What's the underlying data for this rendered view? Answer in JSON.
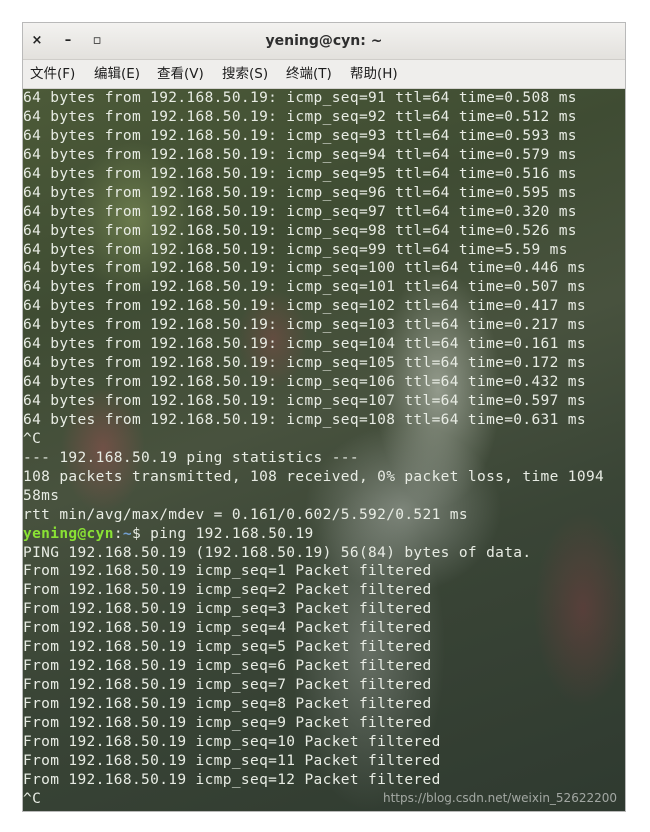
{
  "window": {
    "title": "yening@cyn: ~",
    "close_glyph": "×",
    "minimize_glyph": "–",
    "maximize_glyph": "▫"
  },
  "menu": [
    {
      "label": "文件(F)"
    },
    {
      "label": "编辑(E)"
    },
    {
      "label": "查看(V)"
    },
    {
      "label": "搜索(S)"
    },
    {
      "label": "终端(T)"
    },
    {
      "label": "帮助(H)"
    }
  ],
  "terminal": {
    "lines_before_prompt": [
      "64 bytes from 192.168.50.19: icmp_seq=91 ttl=64 time=0.508 ms",
      "64 bytes from 192.168.50.19: icmp_seq=92 ttl=64 time=0.512 ms",
      "64 bytes from 192.168.50.19: icmp_seq=93 ttl=64 time=0.593 ms",
      "64 bytes from 192.168.50.19: icmp_seq=94 ttl=64 time=0.579 ms",
      "64 bytes from 192.168.50.19: icmp_seq=95 ttl=64 time=0.516 ms",
      "64 bytes from 192.168.50.19: icmp_seq=96 ttl=64 time=0.595 ms",
      "64 bytes from 192.168.50.19: icmp_seq=97 ttl=64 time=0.320 ms",
      "64 bytes from 192.168.50.19: icmp_seq=98 ttl=64 time=0.526 ms",
      "64 bytes from 192.168.50.19: icmp_seq=99 ttl=64 time=5.59 ms",
      "64 bytes from 192.168.50.19: icmp_seq=100 ttl=64 time=0.446 ms",
      "64 bytes from 192.168.50.19: icmp_seq=101 ttl=64 time=0.507 ms",
      "64 bytes from 192.168.50.19: icmp_seq=102 ttl=64 time=0.417 ms",
      "64 bytes from 192.168.50.19: icmp_seq=103 ttl=64 time=0.217 ms",
      "64 bytes from 192.168.50.19: icmp_seq=104 ttl=64 time=0.161 ms",
      "64 bytes from 192.168.50.19: icmp_seq=105 ttl=64 time=0.172 ms",
      "64 bytes from 192.168.50.19: icmp_seq=106 ttl=64 time=0.432 ms",
      "64 bytes from 192.168.50.19: icmp_seq=107 ttl=64 time=0.597 ms",
      "64 bytes from 192.168.50.19: icmp_seq=108 ttl=64 time=0.631 ms",
      "^C",
      "--- 192.168.50.19 ping statistics ---",
      "108 packets transmitted, 108 received, 0% packet loss, time 1094",
      "58ms",
      "rtt min/avg/max/mdev = 0.161/0.602/5.592/0.521 ms"
    ],
    "prompt": {
      "user_host": "yening@cyn",
      "separator": ":",
      "path": "~",
      "symbol": "$",
      "command": " ping 192.168.50.19"
    },
    "lines_after_prompt": [
      "PING 192.168.50.19 (192.168.50.19) 56(84) bytes of data.",
      "From 192.168.50.19 icmp_seq=1 Packet filtered",
      "From 192.168.50.19 icmp_seq=2 Packet filtered",
      "From 192.168.50.19 icmp_seq=3 Packet filtered",
      "From 192.168.50.19 icmp_seq=4 Packet filtered",
      "From 192.168.50.19 icmp_seq=5 Packet filtered",
      "From 192.168.50.19 icmp_seq=6 Packet filtered",
      "From 192.168.50.19 icmp_seq=7 Packet filtered",
      "From 192.168.50.19 icmp_seq=8 Packet filtered",
      "From 192.168.50.19 icmp_seq=9 Packet filtered",
      "From 192.168.50.19 icmp_seq=10 Packet filtered",
      "From 192.168.50.19 icmp_seq=11 Packet filtered",
      "From 192.168.50.19 icmp_seq=12 Packet filtered",
      "^C"
    ]
  },
  "watermark": "https://blog.csdn.net/weixin_52622200",
  "colors": {
    "prompt_user": "#8ae234",
    "prompt_path": "#729fcf",
    "terminal_text": "#e8ece4"
  }
}
